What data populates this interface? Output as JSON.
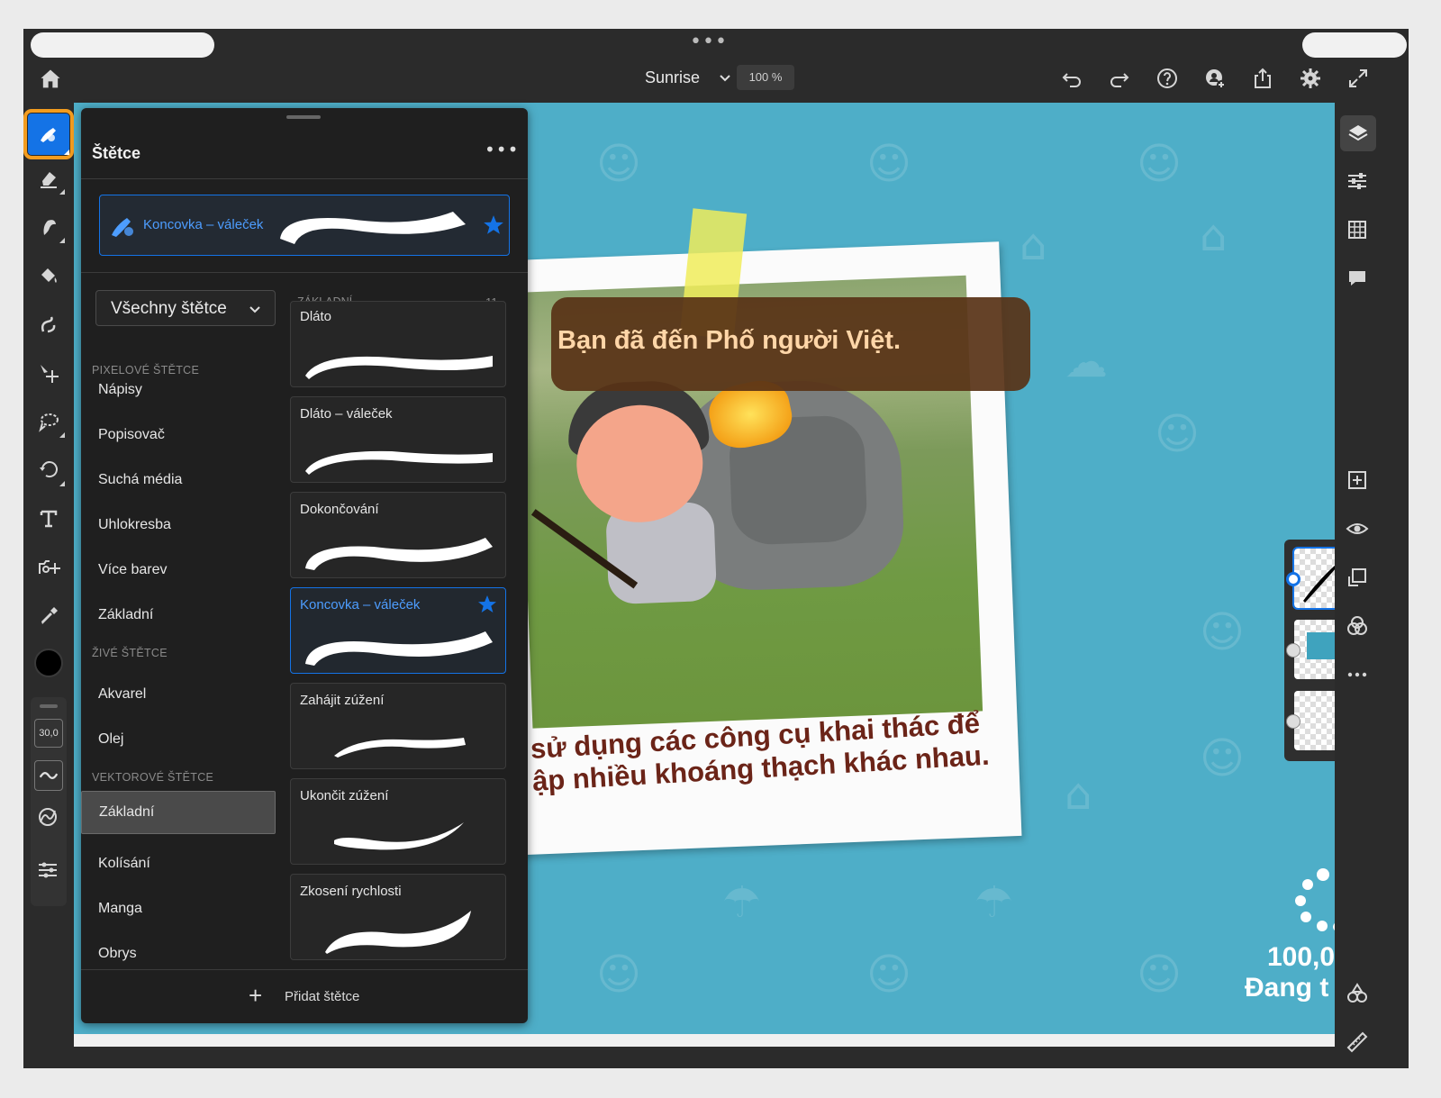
{
  "header": {
    "doc_title": "Sunrise",
    "zoom": "100 %"
  },
  "toolbar": {
    "brush_size": "30,0"
  },
  "panel": {
    "title": "Štětce",
    "current_brush": "Koncovka – váleček",
    "set_dropdown": "Všechny štětce",
    "list_heading": "ZÁKLADNÍ",
    "list_count": "11",
    "categories": [
      {
        "heading": "PIXELOVÉ ŠTĚTCE",
        "items": [
          "Nápisy",
          "Popisovač",
          "Suchá média",
          "Uhlokresba",
          "Více barev",
          "Základní"
        ]
      },
      {
        "heading": "ŽIVÉ ŠTĚTCE",
        "items": [
          "Akvarel",
          "Olej"
        ]
      },
      {
        "heading": "VEKTOROVÉ ŠTĚTCE",
        "items": [
          "Základní",
          "Kolísání",
          "Manga",
          "Obrys"
        ]
      }
    ],
    "brushes": [
      "Dláto",
      "Dláto – váleček",
      "Dokončování",
      "Koncovka – váleček",
      "Zahájit zúžení",
      "Ukončit zúžení",
      "Zkosení rychlosti"
    ],
    "add_label": "Přidat štětce"
  },
  "canvas": {
    "banner_text": "Bạn đã đến Phố người Việt.",
    "caption_line1": "sử dụng các công cụ khai thác để",
    "caption_line2": "ập nhiều khoáng thạch khác nhau.",
    "loading_value": "100,0",
    "loading_text": "Đang t"
  },
  "colors": {
    "accent": "#1473e6",
    "highlight_frame": "#f39c1f",
    "canvas_bg": "#4eaec8",
    "panel_bg": "#1f1f1f",
    "current_color": "#000000"
  }
}
